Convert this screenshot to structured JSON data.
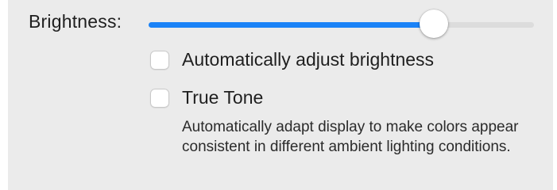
{
  "display": {
    "brightness_label": "Brightness:",
    "brightness_level_percent": 74,
    "accent_color": "#1a82f7",
    "auto_brightness": {
      "label": "Automatically adjust brightness",
      "checked": false
    },
    "true_tone": {
      "label": "True Tone",
      "checked": false,
      "description": "Automatically adapt display to make colors appear consistent in different ambient lighting conditions."
    }
  }
}
